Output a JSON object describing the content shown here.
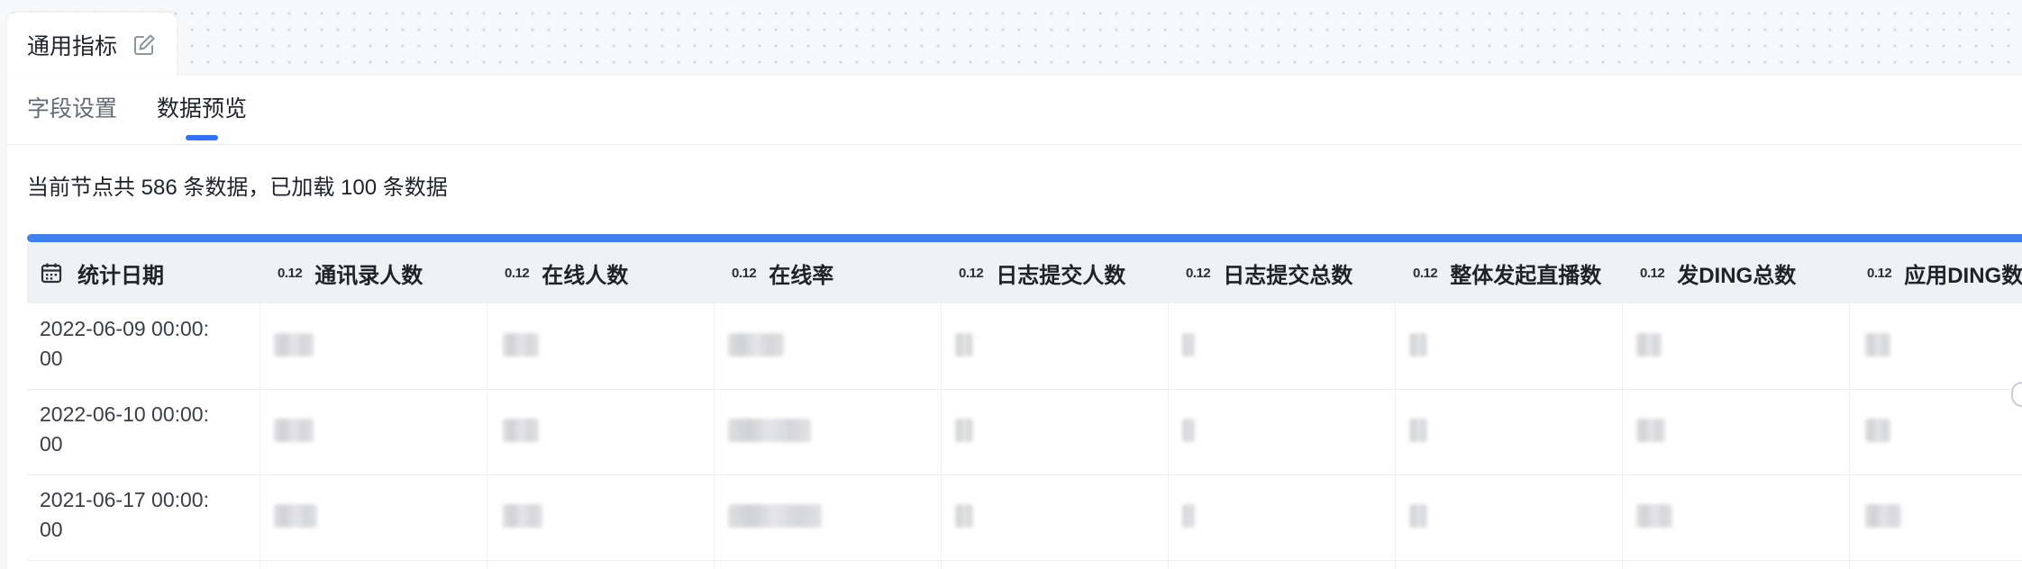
{
  "node": {
    "title": "通用指标"
  },
  "tabs": {
    "fields": "字段设置",
    "preview": "数据预览"
  },
  "summary": "当前节点共 586 条数据，已加载 100 条数据",
  "progress": {
    "loaded_fraction": 1.0,
    "color": "#3f7ff0"
  },
  "table": {
    "numeric_type_label": "0.12",
    "columns": [
      "统计日期",
      "通讯录人数",
      "在线人数",
      "在线率",
      "日志提交人数",
      "日志提交总数",
      "整体发起直播数",
      "发DING总数",
      "应用DING数"
    ],
    "rows": [
      {
        "date_line1": "2022-06-09 00:00:",
        "date_line2": "00"
      },
      {
        "date_line1": "2022-06-10 00:00:",
        "date_line2": "00"
      },
      {
        "date_line1": "2021-06-17 00:00:",
        "date_line2": "00"
      }
    ]
  },
  "colors": {
    "accent": "#3370ff",
    "header_bg": "#eff1f5"
  }
}
